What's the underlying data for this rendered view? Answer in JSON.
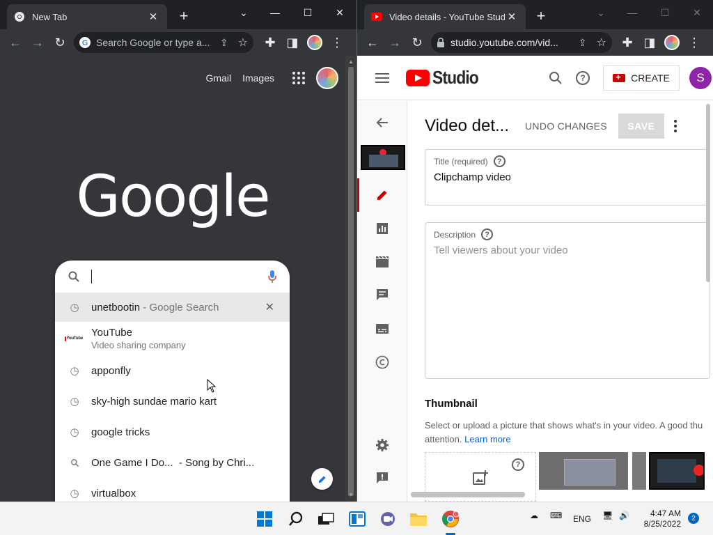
{
  "left_window": {
    "tab_title": "New Tab",
    "omnibox_placeholder": "Search Google or type a...",
    "ntp_links": {
      "gmail": "Gmail",
      "images": "Images"
    },
    "logo_text": "Google",
    "search_input_value": "",
    "suggestions": [
      {
        "icon": "history-icon",
        "text": "unetbootin",
        "suffix": " - Google Search",
        "selected": true
      },
      {
        "icon": "youtube-icon",
        "text": "YouTube",
        "subtext": "Video sharing company",
        "icon_word": "YouTube"
      },
      {
        "icon": "history-icon",
        "text": "apponfly"
      },
      {
        "icon": "history-icon",
        "text": "sky-high sundae mario kart"
      },
      {
        "icon": "history-icon",
        "text": "google tricks"
      },
      {
        "icon": "search-icon",
        "text": "One Game I Do...  - Song by Chri..."
      },
      {
        "icon": "history-icon",
        "text": "virtualbox"
      }
    ]
  },
  "right_window": {
    "tab_title": "Video details - YouTube Studio",
    "url": "studio.youtube.com/vid...",
    "brand": "Studio",
    "create_label": "CREATE",
    "avatar_letter": "S",
    "page_title": "Video det...",
    "undo_label": "UNDO CHANGES",
    "save_label": "SAVE",
    "title_field": {
      "label": "Title (required)",
      "value": "Clipchamp video"
    },
    "description_field": {
      "label": "Description",
      "placeholder": "Tell viewers about your video"
    },
    "thumbnail": {
      "heading": "Thumbnail",
      "description": "Select or upload a picture that shows what's in your video. A good thu",
      "description_line2": "attention. ",
      "learn_more": "Learn more"
    }
  },
  "taskbar": {
    "language": "ENG",
    "time": "4:47 AM",
    "date": "8/25/2022",
    "notification_count": "2"
  },
  "colors": {
    "chrome_dark": "#35363a",
    "youtube_red": "#ff0000",
    "studio_accent": "#cc0000",
    "link_blue": "#065fd4",
    "avatar_purple": "#8e24aa"
  }
}
